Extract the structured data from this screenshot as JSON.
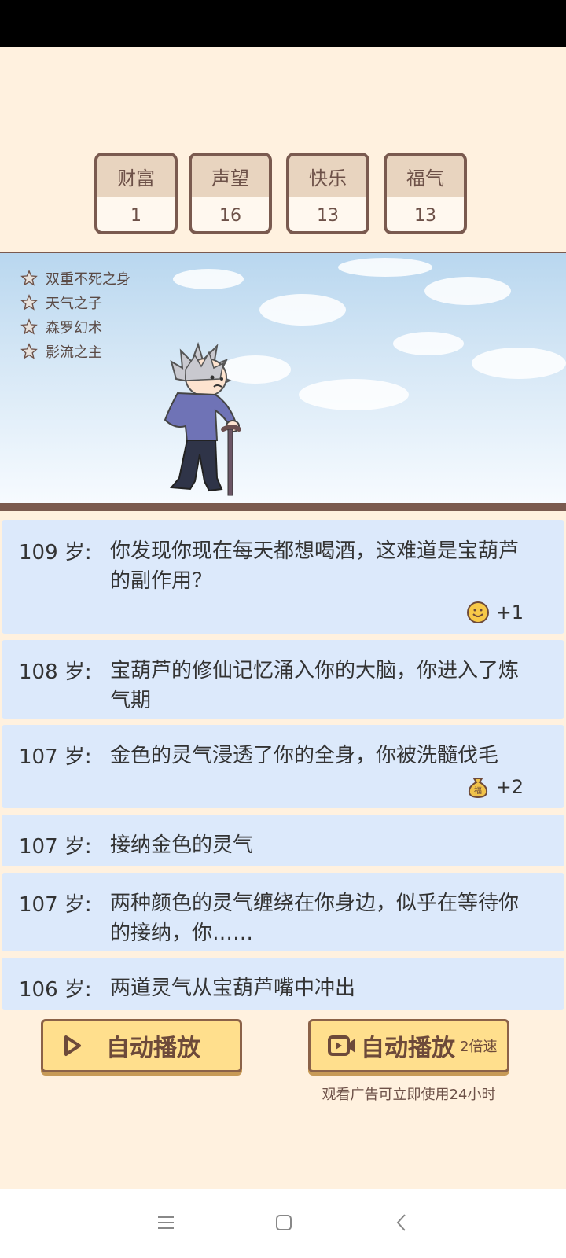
{
  "stats": [
    {
      "label": "财富",
      "value": "1"
    },
    {
      "label": "声望",
      "value": "16"
    },
    {
      "label": "快乐",
      "value": "13"
    },
    {
      "label": "福气",
      "value": "13"
    }
  ],
  "traits": [
    "双重不死之身",
    "天气之子",
    "森罗幻术",
    "影流之主"
  ],
  "log": [
    {
      "age": "109 岁:",
      "text": "你发现你现在每天都想喝酒，这难道是宝葫芦的副作用？",
      "reward": {
        "icon": "smiley-icon",
        "value": "+1"
      }
    },
    {
      "age": "108 岁:",
      "text": "宝葫芦的修仙记忆涌入你的大脑，你进入了炼气期"
    },
    {
      "age": "107 岁:",
      "text": "金色的灵气浸透了你的全身，你被洗髓伐毛",
      "reward": {
        "icon": "money-bag-icon",
        "value": "+2",
        "bag_char": "福"
      }
    },
    {
      "age": "107 岁:",
      "text": "接纳金色的灵气"
    },
    {
      "age": "107 岁:",
      "text": "两种颜色的灵气缠绕在你身边，似乎在等待你的接纳，你……"
    },
    {
      "age": "106 岁:",
      "text": "两道灵气从宝葫芦嘴中冲出"
    }
  ],
  "buttons": {
    "auto_play": "自动播放",
    "auto_play_ad": "自动播放",
    "speed": "2倍速",
    "ad_note": "观看广告可立即使用24小时"
  },
  "colors": {
    "background": "#fff1df",
    "card_border": "#7a5a4f",
    "log_bg": "#dce9fb",
    "button": "#ffdf8d"
  }
}
